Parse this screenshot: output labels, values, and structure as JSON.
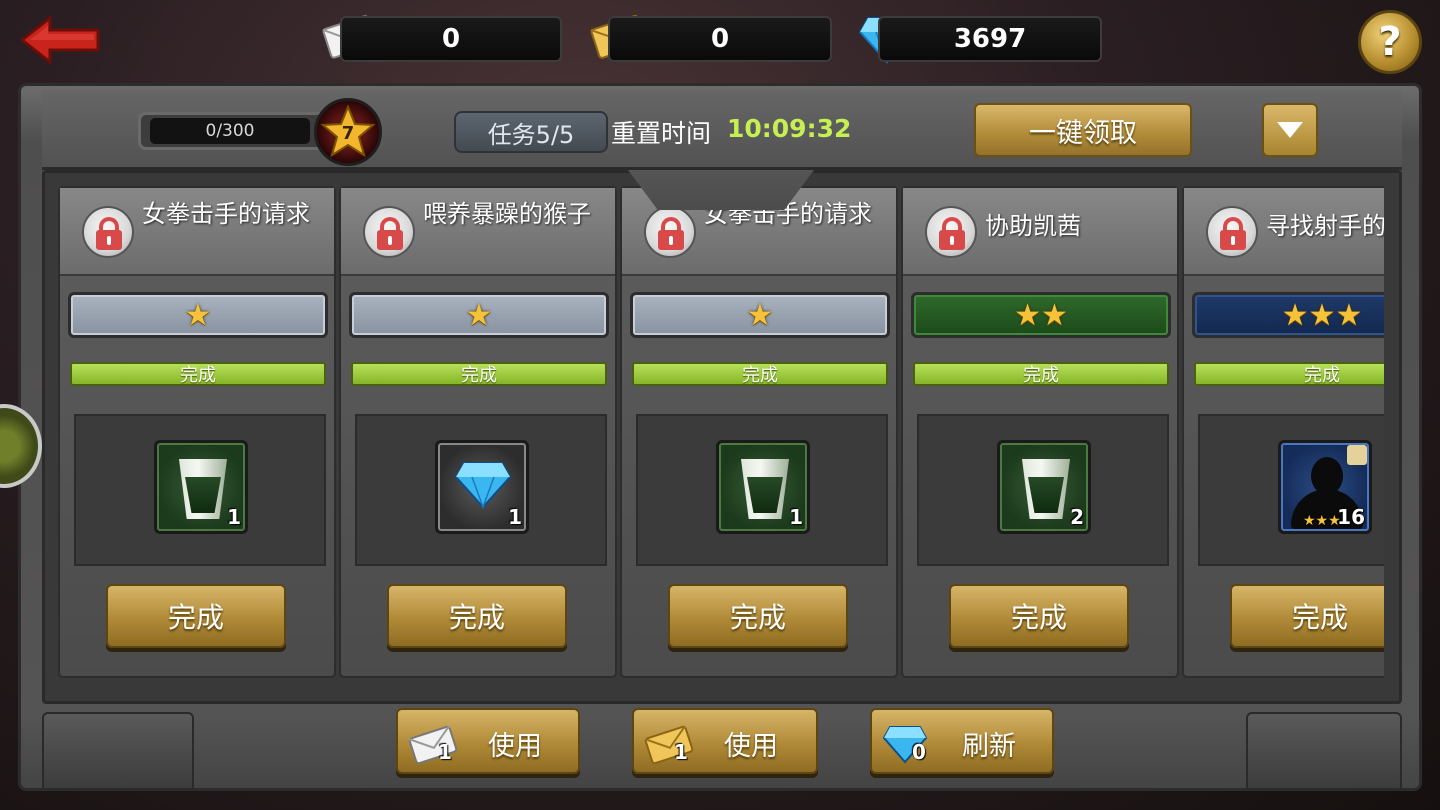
{
  "top_bar": {
    "white_mail_count": "0",
    "gold_mail_count": "0",
    "diamond_count": "3697",
    "help_label": "?"
  },
  "header": {
    "progress_text": "0/300",
    "level": "7",
    "task_label": "任务5/5",
    "reset_label": "重置时间",
    "reset_time": "10:09:32",
    "claim_all_label": "一键领取"
  },
  "quests": [
    {
      "title": "女拳击手的请求",
      "stars": "★",
      "difficulty": 1,
      "status": "完成",
      "reward": "cup",
      "reward_count": "1",
      "button": "完成"
    },
    {
      "title": "喂养暴躁的猴子",
      "stars": "★",
      "difficulty": 1,
      "status": "完成",
      "reward": "diamond",
      "reward_count": "1",
      "button": "完成"
    },
    {
      "title": "女拳击手的请求",
      "stars": "★",
      "difficulty": 1,
      "status": "完成",
      "reward": "cup",
      "reward_count": "1",
      "button": "完成"
    },
    {
      "title": "协助凯茜",
      "stars": "★★",
      "difficulty": 2,
      "status": "完成",
      "reward": "cup",
      "reward_count": "2",
      "button": "完成"
    },
    {
      "title": "寻找射手的",
      "stars": "★★★",
      "difficulty": 3,
      "status": "完成",
      "reward": "hero",
      "reward_count": "16",
      "reward_stars": "★★★",
      "button": "完成"
    }
  ],
  "bottom": {
    "white_mail_btn": {
      "count": "1",
      "label": "使用"
    },
    "gold_mail_btn": {
      "count": "1",
      "label": "使用"
    },
    "refresh_btn": {
      "count": "0",
      "label": "刷新"
    }
  },
  "colors": {
    "accent_gold": "#b08a37",
    "timer_green": "#c5ef52",
    "status_green": "#86b528",
    "lock_red": "#d84a4a"
  }
}
